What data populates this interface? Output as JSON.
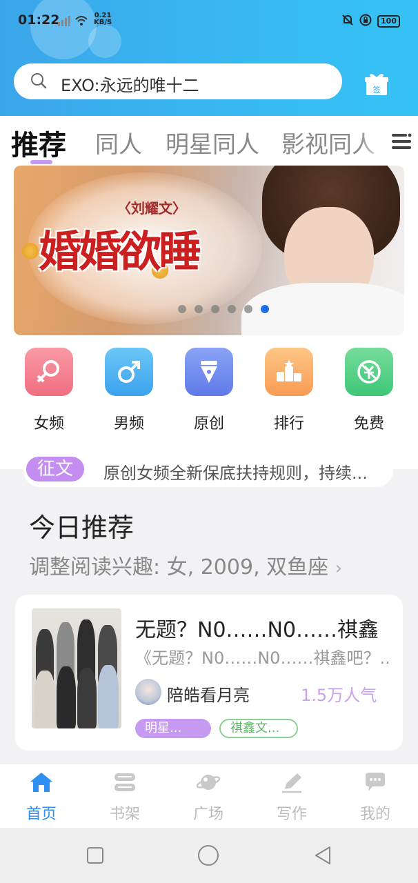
{
  "status_bar": {
    "time": "01:22",
    "network_speed": "0.21",
    "network_unit": "KB/S",
    "battery": "100"
  },
  "search": {
    "text": "EXO:永远的唯十二",
    "gift_label": "签"
  },
  "tabs": [
    {
      "label": "推荐",
      "active": true
    },
    {
      "label": "同人"
    },
    {
      "label": "明星同人"
    },
    {
      "label": "影视同人"
    }
  ],
  "banner": {
    "author": "〈刘耀文〉",
    "title": "婚婚欲睡",
    "slide_count": 6,
    "active_slide": 6
  },
  "categories": [
    {
      "label": "女频",
      "icon": "female-icon",
      "color": "#f37f8e"
    },
    {
      "label": "男频",
      "icon": "male-icon",
      "color": "#4fb6f2"
    },
    {
      "label": "原创",
      "icon": "pen-nib-icon",
      "color": "#6f8cf0"
    },
    {
      "label": "排行",
      "icon": "podium-icon",
      "color": "#fbb46b"
    },
    {
      "label": "免费",
      "icon": "free-yuan-icon",
      "color": "#58d08a"
    }
  ],
  "notice": {
    "tag": "征文",
    "text": "原创女频全新保底扶持规则，持续..."
  },
  "recommend": {
    "title": "今日推荐",
    "subtitle": "调整阅读兴趣: 女, 2009, 双鱼座"
  },
  "book": {
    "title": "无题？N0……N0……祺鑫",
    "description": "《无题？N0……N0……祺鑫吧？...",
    "author": "陪皓看月亮",
    "popularity": "1.5万人气",
    "tags": [
      "明星...",
      "祺鑫文..."
    ]
  },
  "bottom_nav": [
    {
      "label": "首页",
      "icon": "home-icon",
      "active": true
    },
    {
      "label": "书架",
      "icon": "bookshelf-icon"
    },
    {
      "label": "广场",
      "icon": "planet-icon"
    },
    {
      "label": "写作",
      "icon": "pencil-icon"
    },
    {
      "label": "我的",
      "icon": "chat-bubble-icon"
    }
  ],
  "colors": {
    "header": "#38b9f2",
    "accent_purple": "#c69af0",
    "nav_active": "#2f8ff0"
  }
}
